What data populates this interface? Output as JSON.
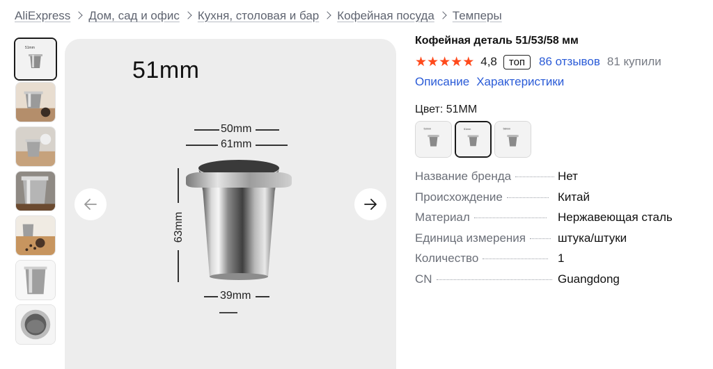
{
  "breadcrumb": [
    "AliExpress",
    "Дом, сад и офис",
    "Кухня, столовая и бар",
    "Кофейная посуда",
    "Темперы"
  ],
  "gallery": {
    "size_label": "51mm",
    "top_width": "50mm",
    "rim_width": "61mm",
    "height": "63mm",
    "bottom_width": "39mm",
    "thumbnail_count": 7
  },
  "product": {
    "title": "Кофейная деталь 51/53/58 мм",
    "rating": "4,8",
    "stars": 5,
    "badge": "топ",
    "reviews": "86 отзывов",
    "sold": "81 купили",
    "links": [
      "Описание",
      "Характеристики"
    ],
    "color_label": "Цвет: 51MM",
    "swatch_count": 3,
    "selected_swatch": 2
  },
  "specs": [
    {
      "key": "Название бренда",
      "value": "Нет"
    },
    {
      "key": "Происхождение",
      "value": "Китай"
    },
    {
      "key": "Материал",
      "value": "Нержавеющая сталь"
    },
    {
      "key": "Единица измерения",
      "value": "штука/штуки"
    },
    {
      "key": "Количество",
      "value": "1"
    },
    {
      "key": "CN",
      "value": "Guangdong"
    }
  ],
  "colors": {
    "link": "#2a5bd7",
    "star": "#ff4a1c",
    "muted": "#6b6f78"
  }
}
